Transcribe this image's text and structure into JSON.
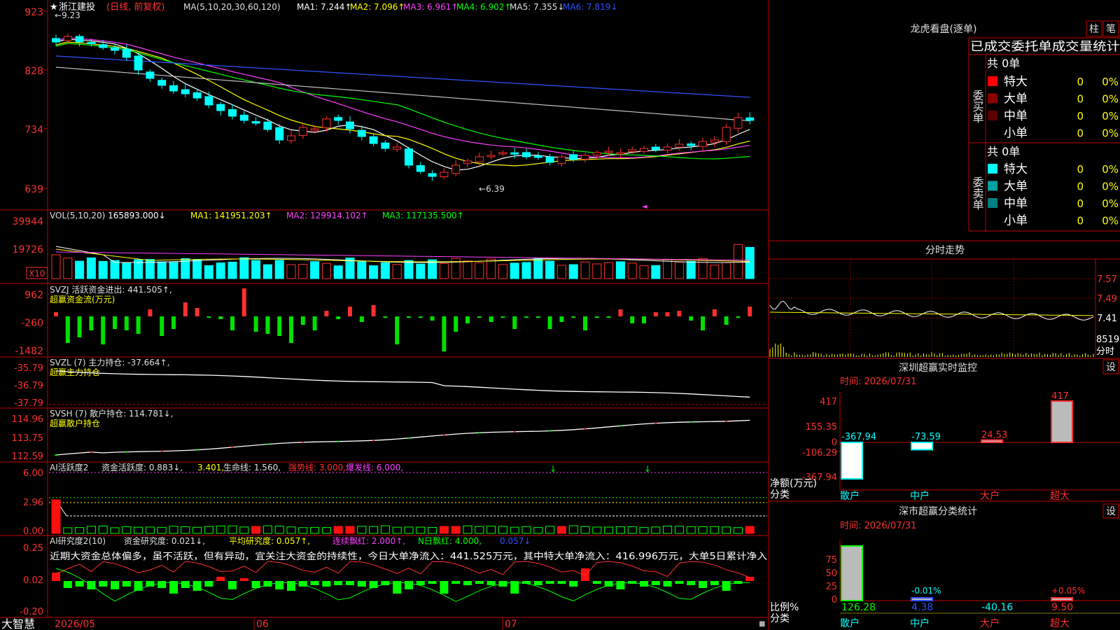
{
  "window": {
    "corner_label": "大智慧"
  },
  "main_chart": {
    "stock_name": "浙江建投",
    "period": "(日线, 前复权)",
    "ma_legend": [
      {
        "label": "MA(5,10,20,30,60,120)",
        "color": "#e0e0e0"
      },
      {
        "label": "MA1: 7.244↑",
        "color": "#ffffff"
      },
      {
        "label": "MA2: 7.096↑",
        "color": "#ffff00"
      },
      {
        "label": "MA3: 6.961↑",
        "color": "#ff40ff"
      },
      {
        "label": "MA4: 6.902↑",
        "color": "#00ff00"
      },
      {
        "label": "MA5: 7.355↓",
        "color": "#e0e0e0"
      },
      {
        "label": "MA6: 7.819↓",
        "color": "#3050ff"
      }
    ],
    "y_ticks": [
      "923",
      "828",
      "734",
      "639"
    ],
    "high_label": "9.23",
    "low_label": "6.39",
    "x_labels": [
      "2026/05",
      "06",
      "07"
    ]
  },
  "vol_panel": {
    "title": "VOL(5,10,20)",
    "value": "165893.000↓",
    "legend": [
      {
        "label": "MA1: 141951.203↑",
        "color": "#ffff00"
      },
      {
        "label": "MA2: 129914.102↑",
        "color": "#ff40ff"
      },
      {
        "label": "MA3: 117135.500↑",
        "color": "#00ff00"
      }
    ],
    "y_ticks": [
      "39944",
      "19726"
    ],
    "unit": "X10"
  },
  "svzj_panel": {
    "title": "SVZJ",
    "name": "活跃资金进出: 441.505↑,",
    "subtitle": "超赢资金流(万元)",
    "y_ticks": [
      "962",
      "-260",
      "-1482"
    ]
  },
  "svzl_panel": {
    "title": "SVZL (7)",
    "name": "主力持仓: -37.664↑,",
    "subtitle": "超赢主力持仓",
    "y_ticks": [
      "-35.79",
      "-36.79",
      "-37.79"
    ]
  },
  "svsh_panel": {
    "title": "SVSH (7)",
    "name": "散户持仓: 114.781↓,",
    "subtitle": "超赢散户持仓",
    "y_ticks": [
      "114.96",
      "113.75",
      "112.59"
    ]
  },
  "ai_active_panel": {
    "title": "AI活跃度2",
    "items": [
      {
        "label": "资金活跃度: 0.883↓,",
        "color": "#e0e0e0"
      },
      {
        "label": "3.401,",
        "color": "#ffff00"
      },
      {
        "label": "生命线: 1.560,",
        "color": "#e0e0e0"
      },
      {
        "label": "强势线: 3.000,",
        "color": "#ff3030"
      },
      {
        "label": "爆发线: 6.000,",
        "color": "#ff40ff"
      }
    ],
    "y_ticks": [
      "6.00",
      "2.96",
      "0.00"
    ]
  },
  "ai_research_panel": {
    "title": "AI研究度2(10)",
    "items": [
      {
        "label": "资金研究度: 0.021↓,",
        "color": "#e0e0e0"
      },
      {
        "label": "平均研究度: 0.057↑,",
        "color": "#ffff00"
      },
      {
        "label": "连续飘红: 2.000↑,",
        "color": "#ff40ff"
      },
      {
        "label": "N日飘红: 4.000,",
        "color": "#00ff00"
      },
      {
        "label": "0.057↓",
        "color": "#3050ff"
      }
    ],
    "comment": "近期大资金总体偏多，虽不活跃，但有异动，宜关注大资金的持续性，今日大单净流入：441.525万元，其中特大单净流入：416.996万元，大单5日累计净入",
    "y_ticks": [
      "0.25",
      "0.02",
      "-0.20"
    ]
  },
  "dragon_tiger": {
    "title": "龙虎看盘(逐单)",
    "buttons": [
      "柱",
      "笔"
    ],
    "subtitle": "已成交委托单成交量统计",
    "buy": {
      "side_label": "委买单",
      "total": "共 0单",
      "rows": [
        {
          "label": "特大",
          "count": "0",
          "pct": "0%",
          "color": "#ff0000"
        },
        {
          "label": "大单",
          "count": "0",
          "pct": "0%",
          "color": "#8b0000"
        },
        {
          "label": "中单",
          "count": "0",
          "pct": "0%",
          "color": "#5a0000"
        },
        {
          "label": "小单",
          "count": "0",
          "pct": "0%",
          "color": ""
        }
      ]
    },
    "sell": {
      "side_label": "委卖单",
      "total": "共 0单",
      "rows": [
        {
          "label": "特大",
          "count": "0",
          "pct": "0%",
          "color": "#00ffff"
        },
        {
          "label": "大单",
          "count": "0",
          "pct": "0%",
          "color": "#00a0a0"
        },
        {
          "label": "中单",
          "count": "0",
          "pct": "0%",
          "color": "#008080"
        },
        {
          "label": "小单",
          "count": "0",
          "pct": "0%",
          "color": ""
        }
      ]
    }
  },
  "intraday": {
    "title": "分时走势",
    "y_ticks": [
      "7.57",
      "7.49",
      "7.41"
    ],
    "vol_label": "8519",
    "vol_sublabel": "分时"
  },
  "realtime_monitor": {
    "title": "深圳超赢实时监控",
    "set_button": "设",
    "time": "时间: 2026/07/31",
    "y_ticks": [
      "417",
      "155.35",
      "0",
      "-106.29",
      "-367.94"
    ],
    "y_label": "净额(万元)",
    "x_title": "分类",
    "categories": [
      "散户",
      "中户",
      "大户",
      "超大"
    ],
    "values": [
      -367.94,
      -73.59,
      24.53,
      417
    ],
    "value_labels": [
      "-367.94",
      "-73.59",
      "24.53",
      "417"
    ]
  },
  "class_stats": {
    "title": "深市超赢分类统计",
    "set_button": "设",
    "time": "时间: 2026/07/31",
    "y_ticks": [
      "75",
      "50",
      "25",
      "0"
    ],
    "y_label": "比例%",
    "x_title": "分类",
    "categories": [
      "散户",
      "中户",
      "大户",
      "超大"
    ],
    "bar_values": [
      100,
      -0.01,
      0,
      0.05
    ],
    "bar_labels": [
      "",
      "-0.01%",
      "",
      "+0.05%"
    ],
    "values": [
      "126.28",
      "4.38",
      "-40.16",
      "9.50"
    ]
  },
  "colors": {
    "up": "#ff3030",
    "down": "#00ffff",
    "frame": "#c00000"
  }
}
